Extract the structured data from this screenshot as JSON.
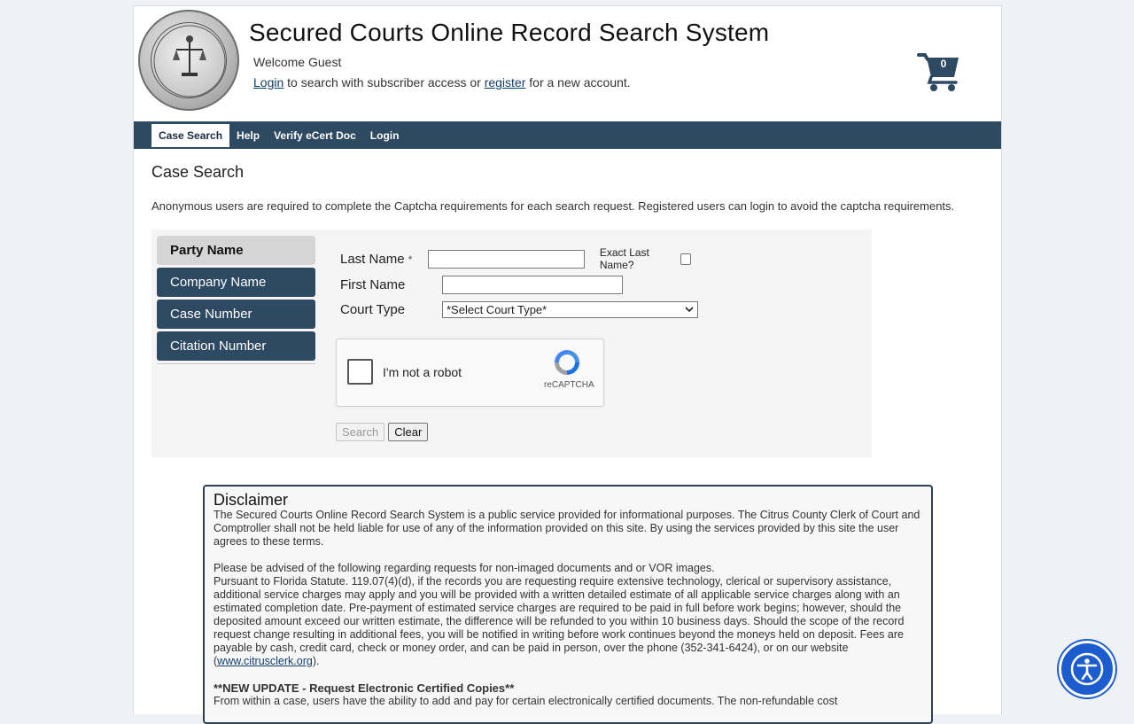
{
  "header": {
    "title": "Secured Courts Online Record Search System",
    "welcome": "Welcome Guest",
    "login_link": "Login",
    "login_text_1": " to search with subscriber access or ",
    "register_link": "register",
    "login_text_2": " for a new account.",
    "cart_count": "0"
  },
  "nav": {
    "items": [
      {
        "label": "Case Search"
      },
      {
        "label": "Help"
      },
      {
        "label": "Verify eCert Doc"
      },
      {
        "label": "Login"
      }
    ]
  },
  "main": {
    "title": "Case Search",
    "notice": "Anonymous users are required to complete the Captcha requirements for each search request. Registered users can login to avoid the captcha requirements."
  },
  "tabs": [
    {
      "label": "Party Name"
    },
    {
      "label": "Company Name"
    },
    {
      "label": "Case Number"
    },
    {
      "label": "Citation Number"
    }
  ],
  "form": {
    "last_name_label": "Last Name",
    "required_mark": "*",
    "last_name_value": "",
    "exact_label": "Exact Last Name?",
    "first_name_label": "First Name",
    "first_name_value": "",
    "court_type_label": "Court Type",
    "court_type_selected": "*Select Court Type*"
  },
  "captcha": {
    "label": "I'm not a robot",
    "brand": "reCAPTCHA"
  },
  "buttons": {
    "search": "Search",
    "clear": "Clear"
  },
  "disclaimer": {
    "title": "Disclaimer",
    "para1": "The Secured Courts Online Record Search System is a public service provided for informational purposes. The Citrus County Clerk of Court and Comptroller shall not be held liable for use of any of the information provided on this site. By using the services provided by this site the user agrees to these terms.",
    "para2_line1": "Please be advised of the following regarding requests for non-imaged documents and or VOR images.",
    "para2_body": "Pursuant to Florida Statute. 119.07(4)(d), if the records you are requesting require extensive technology, clerical or supervisory assistance, additional service charges may apply and you will be provided with a written detailed estimate of all applicable service charges along with an estimated completion date. Pre-payment of estimated service charges are required to be paid in full before work begins; however, should the deposited amount exceed our written estimate, the difference will be refunded to you within 10 business days. Should the scope of the record request change resulting in additional fees, you will be notified in writing before work continues beyond the moneys held on deposit. Fees are payable by cash, credit card, check or money order, and can be paid in person, over the phone (352-341-6424), or on our website (",
    "website_link": "www.citrusclerk.org",
    "para2_end": ").",
    "update_title": "**NEW UPDATE - Request Electronic Certified Copies**",
    "update_body": "From within a case, users have the ability to add and pay for certain electronically certified documents. The non-refundable cost"
  },
  "colors": {
    "nav_bg": "#2d4a62",
    "accessibility_bg": "#1d5ccf"
  }
}
